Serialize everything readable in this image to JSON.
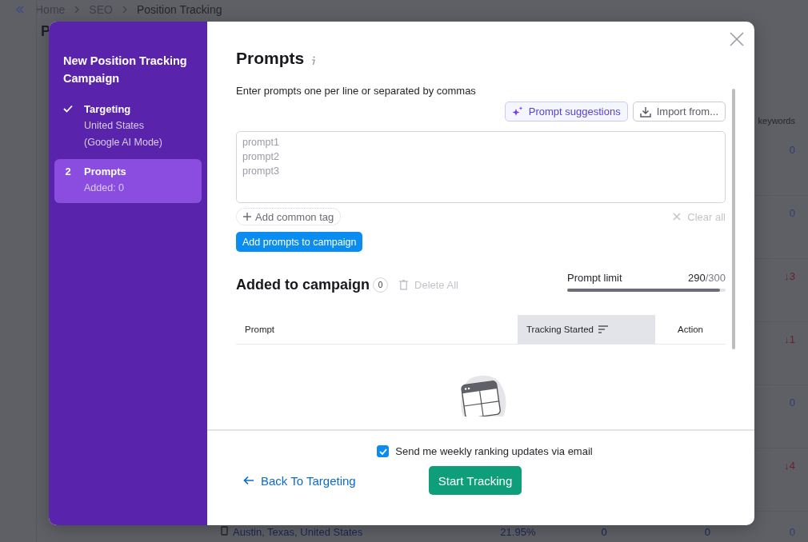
{
  "breadcrumbs": [
    {
      "label": "Home"
    },
    {
      "label": "SEO"
    },
    {
      "label": "Position Tracking"
    }
  ],
  "page_title": "P",
  "background_table": {
    "column_header": "keywords",
    "rows": [
      {
        "change": "0",
        "down": false
      },
      {
        "change": "0",
        "down": false
      },
      {
        "change": "↓3",
        "down": true
      },
      {
        "change": "↓1",
        "down": true
      },
      {
        "change": "0",
        "down": false
      },
      {
        "change": "↓4",
        "down": true
      },
      {
        "location": "Austin, Texas, United States",
        "share": "21.95%",
        "col_a": "0",
        "col_b": "0",
        "change": "0",
        "down": false
      }
    ]
  },
  "modal": {
    "sidebar": {
      "title": "New Position Tracking Campaign",
      "steps": [
        {
          "title": "Targeting",
          "lines": [
            "United States",
            "(Google AI Mode)"
          ],
          "done": true,
          "selected": false
        },
        {
          "number": "2",
          "title": "Prompts",
          "lines": [
            "Added: 0"
          ],
          "done": false,
          "selected": true
        }
      ]
    },
    "title": "Prompts",
    "instructions": "Enter prompts one per line or separated by commas",
    "suggest_button": "Prompt suggestions",
    "import_button": "Import from...",
    "prompts_field": {
      "placeholder": "prompt1\nprompt2\nprompt3"
    },
    "add_tag": "Add common tag",
    "clear_all": {
      "label": "Clear all",
      "disabled": true
    },
    "add_button": "Add prompts to campaign",
    "added": {
      "title": "Added to campaign",
      "count": "0",
      "delete_all": {
        "label": "Delete All",
        "disabled": true
      },
      "limit": {
        "label": "Prompt limit",
        "used": "290",
        "total": "/300",
        "level": 0.967
      }
    },
    "table": {
      "columns": [
        {
          "label": "Prompt",
          "sorted": false
        },
        {
          "label": "Tracking Started",
          "sorted": true
        },
        {
          "label": "Action",
          "sorted": false
        }
      ]
    },
    "footer": {
      "email_updates": {
        "label": "Send me weekly ranking updates via email",
        "checked": true
      },
      "back_link": "Back To Targeting",
      "start_button": "Start Tracking"
    }
  }
}
